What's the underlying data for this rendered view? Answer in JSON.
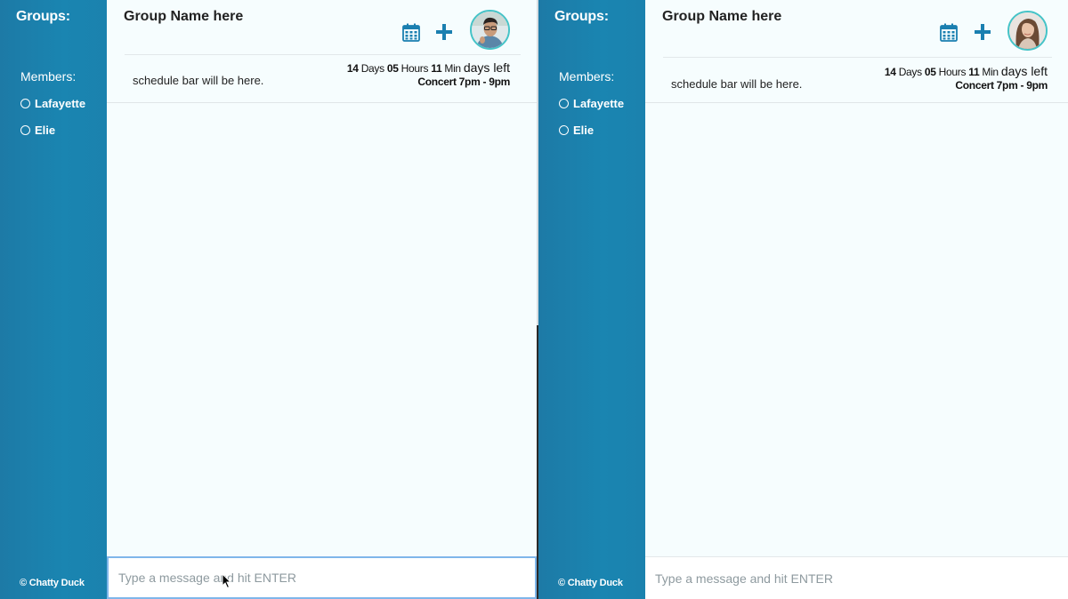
{
  "colors": {
    "sidebar": "#1a85b1",
    "accent": "#1a7fb0",
    "avatar_ring": "#45c3c7",
    "chat_bg": "#f6fdfe"
  },
  "left": {
    "sidebar": {
      "groups_label": "Groups:",
      "members_label": "Members:",
      "members": [
        {
          "name": "Lafayette"
        },
        {
          "name": "Elie"
        }
      ],
      "footer": "© Chatty Duck"
    },
    "header": {
      "group_name": "Group Name here",
      "schedule": "schedule bar will be here.",
      "countdown": {
        "days": "14",
        "days_unit": "Days",
        "hours": "05",
        "hours_unit": "Hours",
        "minutes": "11",
        "minutes_unit": "Min",
        "suffix": "days left"
      },
      "event": "Concert 7pm - 9pm",
      "icons": {
        "calendar": "calendar-icon",
        "add": "plus-icon",
        "avatar": "user-avatar"
      }
    },
    "composer": {
      "placeholder": "Type a message and hit ENTER",
      "value": ""
    }
  },
  "right": {
    "sidebar": {
      "groups_label": "Groups:",
      "members_label": "Members:",
      "members": [
        {
          "name": "Lafayette"
        },
        {
          "name": "Elie"
        }
      ],
      "footer": "© Chatty Duck"
    },
    "header": {
      "group_name": "Group Name here",
      "schedule": "schedule bar will be here.",
      "countdown": {
        "days": "14",
        "days_unit": "Days",
        "hours": "05",
        "hours_unit": "Hours",
        "minutes": "11",
        "minutes_unit": "Min",
        "suffix": "days left"
      },
      "event": "Concert 7pm - 9pm",
      "icons": {
        "calendar": "calendar-icon",
        "add": "plus-icon",
        "avatar": "user-avatar"
      }
    },
    "composer": {
      "placeholder": "Type a message and hit ENTER",
      "value": ""
    }
  }
}
